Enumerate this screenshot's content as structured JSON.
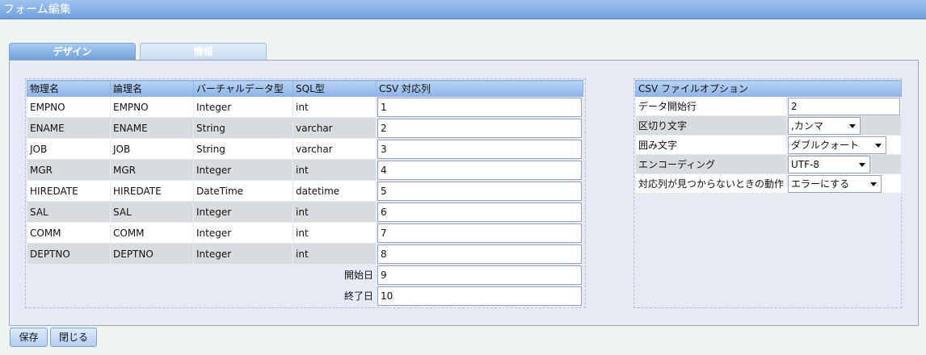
{
  "window": {
    "title": "フォーム編集"
  },
  "tabs": [
    {
      "label": "デザイン"
    },
    {
      "label": "情報"
    }
  ],
  "columns_table": {
    "headers": [
      "物理名",
      "論理名",
      "バーチャルデータ型",
      "SQL型",
      "CSV 対応列"
    ],
    "rows": [
      {
        "physical": "EMPNO",
        "logical": "EMPNO",
        "vtype": "Integer",
        "sqltype": "int",
        "csv": "1"
      },
      {
        "physical": "ENAME",
        "logical": "ENAME",
        "vtype": "String",
        "sqltype": "varchar",
        "csv": "2"
      },
      {
        "physical": "JOB",
        "logical": "JOB",
        "vtype": "String",
        "sqltype": "varchar",
        "csv": "3"
      },
      {
        "physical": "MGR",
        "logical": "MGR",
        "vtype": "Integer",
        "sqltype": "int",
        "csv": "4"
      },
      {
        "physical": "HIREDATE",
        "logical": "HIREDATE",
        "vtype": "DateTime",
        "sqltype": "datetime",
        "csv": "5"
      },
      {
        "physical": "SAL",
        "logical": "SAL",
        "vtype": "Integer",
        "sqltype": "int",
        "csv": "6"
      },
      {
        "physical": "COMM",
        "logical": "COMM",
        "vtype": "Integer",
        "sqltype": "int",
        "csv": "7"
      },
      {
        "physical": "DEPTNO",
        "logical": "DEPTNO",
        "vtype": "Integer",
        "sqltype": "int",
        "csv": "8"
      }
    ],
    "extra": [
      {
        "label": "開始日",
        "csv": "9"
      },
      {
        "label": "終了日",
        "csv": "10"
      }
    ]
  },
  "csv_options": {
    "header": "CSV ファイルオプション",
    "start_row": {
      "label": "データ開始行",
      "value": "2"
    },
    "delimiter": {
      "label": "区切り文字",
      "value": ",カンマ"
    },
    "quote": {
      "label": "囲み文字",
      "value": "ダブルクォート"
    },
    "encoding": {
      "label": "エンコーディング",
      "value": "UTF-8"
    },
    "missing": {
      "label": "対応列が見つからないときの動作",
      "value": "エラーにする"
    }
  },
  "buttons": {
    "save": "保存",
    "close": "閉じる"
  }
}
